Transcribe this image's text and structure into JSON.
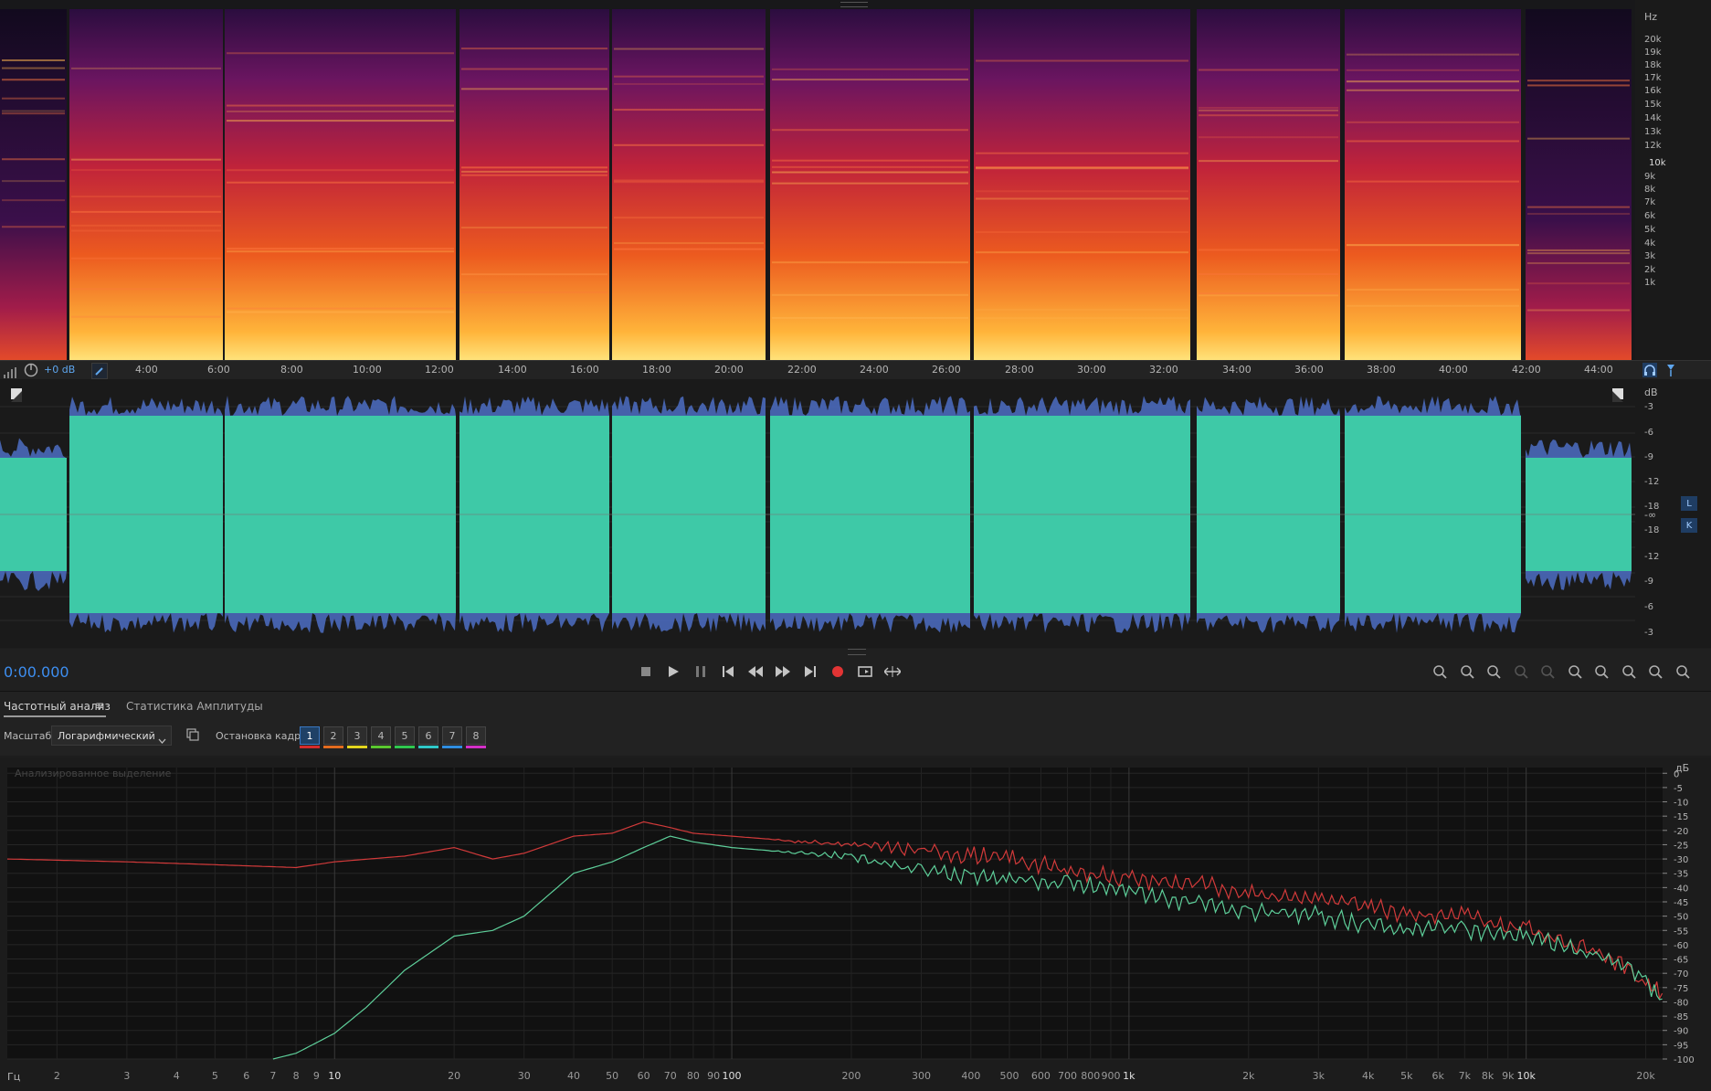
{
  "spectral": {
    "unit": "Hz",
    "freq_labels": [
      "20k",
      "19k",
      "18k",
      "17k",
      "16k",
      "15k",
      "14k",
      "13k",
      "12k",
      "10k",
      "9k",
      "8k",
      "7k",
      "6k",
      "5k",
      "4k",
      "3k",
      "2k",
      "1k"
    ]
  },
  "ruler": {
    "gain_label": "+0 dB",
    "time_labels": [
      "4:00",
      "6:00",
      "8:00",
      "10:00",
      "12:00",
      "14:00",
      "16:00",
      "18:00",
      "20:00",
      "22:00",
      "24:00",
      "26:00",
      "28:00",
      "30:00",
      "32:00",
      "34:00",
      "36:00",
      "38:00",
      "40:00",
      "42:00",
      "44:00"
    ]
  },
  "waveform": {
    "unit": "dB",
    "db_labels_top": [
      "-3",
      "-6",
      "-9",
      "-12",
      "-18"
    ],
    "center_label": "-∞",
    "db_labels_bottom": [
      "-18",
      "-12",
      "-9",
      "-6",
      "-3"
    ],
    "channel_left": "L",
    "channel_right": "K",
    "colors": {
      "wave": "#3ec9a7",
      "peak": "#4e6fc4"
    }
  },
  "transport": {
    "time": "0:00.000",
    "buttons": [
      "stop-icon",
      "play-icon",
      "pause-icon",
      "go-to-start-icon",
      "rewind-icon",
      "fast-forward-icon",
      "go-to-end-icon",
      "record-icon",
      "loop-icon",
      "skip-selection-icon"
    ],
    "zoom_buttons": [
      "zoom-in-amplitude-icon",
      "zoom-out-amplitude-icon",
      "zoom-reset-icon",
      "zoom-in-disabled-icon",
      "zoom-out-disabled-icon",
      "zoom-in-left-icon",
      "zoom-in-right-icon",
      "zoom-selection-icon",
      "zoom-full-icon",
      "zoom-to-selection-icon"
    ]
  },
  "panel": {
    "tab_frequency": "Частотный анализ",
    "tab_amplitude": "Статистика Амплитуды"
  },
  "toolbar": {
    "scale_label": "Масштаб:",
    "scale_value": "Логарифмический",
    "freeze_label": "Остановка кадра:",
    "frames": [
      "1",
      "2",
      "3",
      "4",
      "5",
      "6",
      "7",
      "8"
    ],
    "frame_colors": [
      "#d62b2b",
      "#e36b1e",
      "#e3d51e",
      "#5ac82f",
      "#2fc84f",
      "#2fc8c8",
      "#2f8de0",
      "#d42fc8"
    ]
  },
  "chart_data": {
    "type": "line",
    "title": "Анализированное выделение",
    "xlabel": "Гц",
    "ylabel": "дБ",
    "x_scale": "log",
    "xlim": [
      1.5,
      22050
    ],
    "ylim": [
      -100,
      2
    ],
    "x_ticks": [
      "2",
      "3",
      "4",
      "5",
      "6",
      "7",
      "8",
      "9",
      "10",
      "20",
      "30",
      "40",
      "50",
      "60",
      "70",
      "80",
      "90",
      "100",
      "200",
      "300",
      "400",
      "500",
      "600",
      "700",
      "800",
      "900",
      "1k",
      "2k",
      "3k",
      "4k",
      "5k",
      "6k",
      "7k",
      "8k",
      "9k",
      "10k",
      "20k"
    ],
    "y_ticks": [
      "0",
      "-5",
      "-10",
      "-15",
      "-20",
      "-25",
      "-30",
      "-35",
      "-40",
      "-45",
      "-50",
      "-55",
      "-60",
      "-65",
      "-70",
      "-75",
      "-80",
      "-85",
      "-90",
      "-95",
      "-100"
    ],
    "grid": true,
    "series": [
      {
        "color": "#d23a3a",
        "x": [
          1.5,
          3,
          5,
          8,
          10,
          15,
          20,
          25,
          30,
          40,
          50,
          60,
          70,
          80,
          100,
          150,
          200,
          300,
          400,
          500,
          700,
          1000,
          1500,
          2000,
          3000,
          4000,
          5000,
          6000,
          7000,
          8000,
          10000,
          12000,
          15000,
          18000,
          20000,
          21000,
          22000
        ],
        "y": [
          -30,
          -31,
          -32,
          -33,
          -31,
          -29,
          -26,
          -30,
          -28,
          -22,
          -21,
          -17,
          -19,
          -21,
          -22,
          -24,
          -25,
          -27,
          -29,
          -30,
          -34,
          -37,
          -39,
          -42,
          -44,
          -46,
          -49,
          -50,
          -49,
          -53,
          -54,
          -58,
          -62,
          -68,
          -74,
          -75,
          -77
        ]
      },
      {
        "color": "#5ecf9a",
        "x": [
          7,
          8,
          10,
          12,
          15,
          20,
          25,
          30,
          40,
          50,
          60,
          70,
          80,
          100,
          150,
          200,
          300,
          400,
          500,
          700,
          1000,
          1500,
          2000,
          3000,
          4000,
          5000,
          6000,
          7000,
          8000,
          10000,
          12000,
          15000,
          18000,
          20000,
          21000,
          22000
        ],
        "y": [
          -100,
          -98,
          -91,
          -82,
          -69,
          -57,
          -55,
          -50,
          -35,
          -31,
          -26,
          -22,
          -24,
          -26,
          -28,
          -29,
          -34,
          -36,
          -37,
          -39,
          -41,
          -46,
          -48,
          -50,
          -53,
          -55,
          -54,
          -54,
          -56,
          -57,
          -60,
          -64,
          -68,
          -73,
          -77,
          -79
        ]
      }
    ]
  }
}
